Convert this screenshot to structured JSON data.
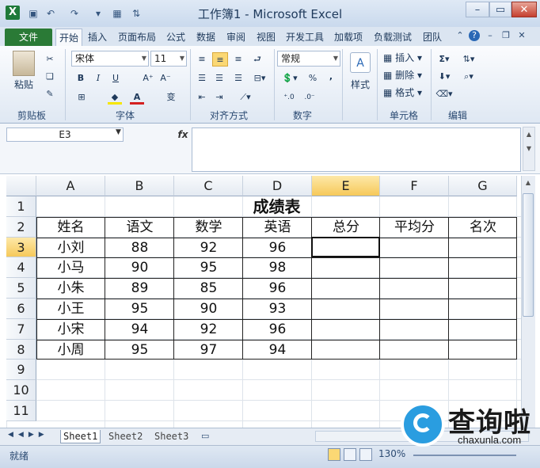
{
  "window": {
    "title": "工作簿1 - Microsoft Excel"
  },
  "tabs": [
    {
      "label": "文件"
    },
    {
      "label": "开始"
    },
    {
      "label": "插入"
    },
    {
      "label": "页面布局"
    },
    {
      "label": "公式"
    },
    {
      "label": "数据"
    },
    {
      "label": "审阅"
    },
    {
      "label": "视图"
    },
    {
      "label": "开发工具"
    },
    {
      "label": "加载项"
    },
    {
      "label": "负载测试"
    },
    {
      "label": "团队"
    }
  ],
  "ribbon": {
    "paste_label": "粘贴",
    "font_name": "宋体",
    "font_size": "11",
    "number_format": "常规",
    "style_label": "样式",
    "insert_label": "插入",
    "delete_label": "删除",
    "format_label": "格式",
    "groups": {
      "clipboard": "剪贴板",
      "font": "字体",
      "alignment": "对齐方式",
      "number": "数字",
      "cells": "单元格",
      "editing": "编辑"
    },
    "bold": "B",
    "italic": "I",
    "underline": "U",
    "percent": "%",
    "comma": ","
  },
  "formula_bar": {
    "name_box": "E3",
    "fx": "fx",
    "value": ""
  },
  "columns": [
    "A",
    "B",
    "C",
    "D",
    "E",
    "F",
    "G"
  ],
  "selected_column": "E",
  "rows": [
    "1",
    "2",
    "3",
    "4",
    "5",
    "6",
    "7",
    "8",
    "9",
    "10",
    "11"
  ],
  "selected_row": "3",
  "sheet": {
    "title": "成绩表",
    "headers": [
      "姓名",
      "语文",
      "数学",
      "英语",
      "总分",
      "平均分",
      "名次"
    ],
    "records": [
      [
        "小刘",
        "88",
        "92",
        "96",
        "",
        "",
        ""
      ],
      [
        "小马",
        "90",
        "95",
        "98",
        "",
        "",
        ""
      ],
      [
        "小朱",
        "89",
        "85",
        "96",
        "",
        "",
        ""
      ],
      [
        "小王",
        "95",
        "90",
        "93",
        "",
        "",
        ""
      ],
      [
        "小宋",
        "94",
        "92",
        "96",
        "",
        "",
        ""
      ],
      [
        "小周",
        "95",
        "97",
        "94",
        "",
        "",
        ""
      ]
    ]
  },
  "sheet_tabs": [
    "Sheet1",
    "Sheet2",
    "Sheet3"
  ],
  "status": {
    "text": "就绪",
    "zoom": "130%"
  },
  "watermark": {
    "text": "查询啦",
    "url": "chaxunla.com"
  }
}
